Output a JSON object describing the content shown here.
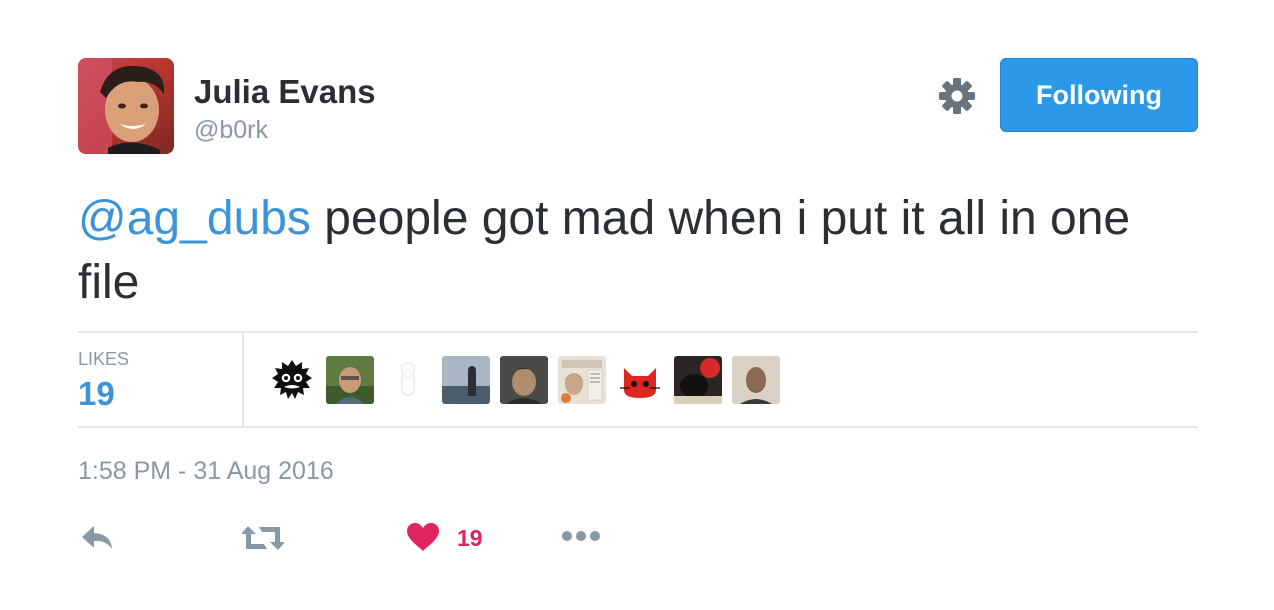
{
  "user": {
    "name": "Julia Evans",
    "handle": "@b0rk"
  },
  "follow_button": {
    "label": "Following",
    "color": "#2b99e8"
  },
  "tweet": {
    "mention": "@ag_dubs",
    "text": " people got mad when i put it all in one file"
  },
  "stats": {
    "likes_label": "LIKES",
    "likes_count": "19"
  },
  "timestamp": "1:58 PM - 31 Aug 2016",
  "actions": {
    "like_count": "19"
  },
  "icons": {
    "settings": "gear-icon",
    "reply": "reply-icon",
    "retweet": "retweet-icon",
    "like": "heart-icon",
    "more": "more-icon"
  },
  "colors": {
    "text": "#292f33",
    "secondary": "#8899a6",
    "link": "#3b94d9",
    "like": "#e0245e",
    "divider": "#e1e8ed"
  }
}
